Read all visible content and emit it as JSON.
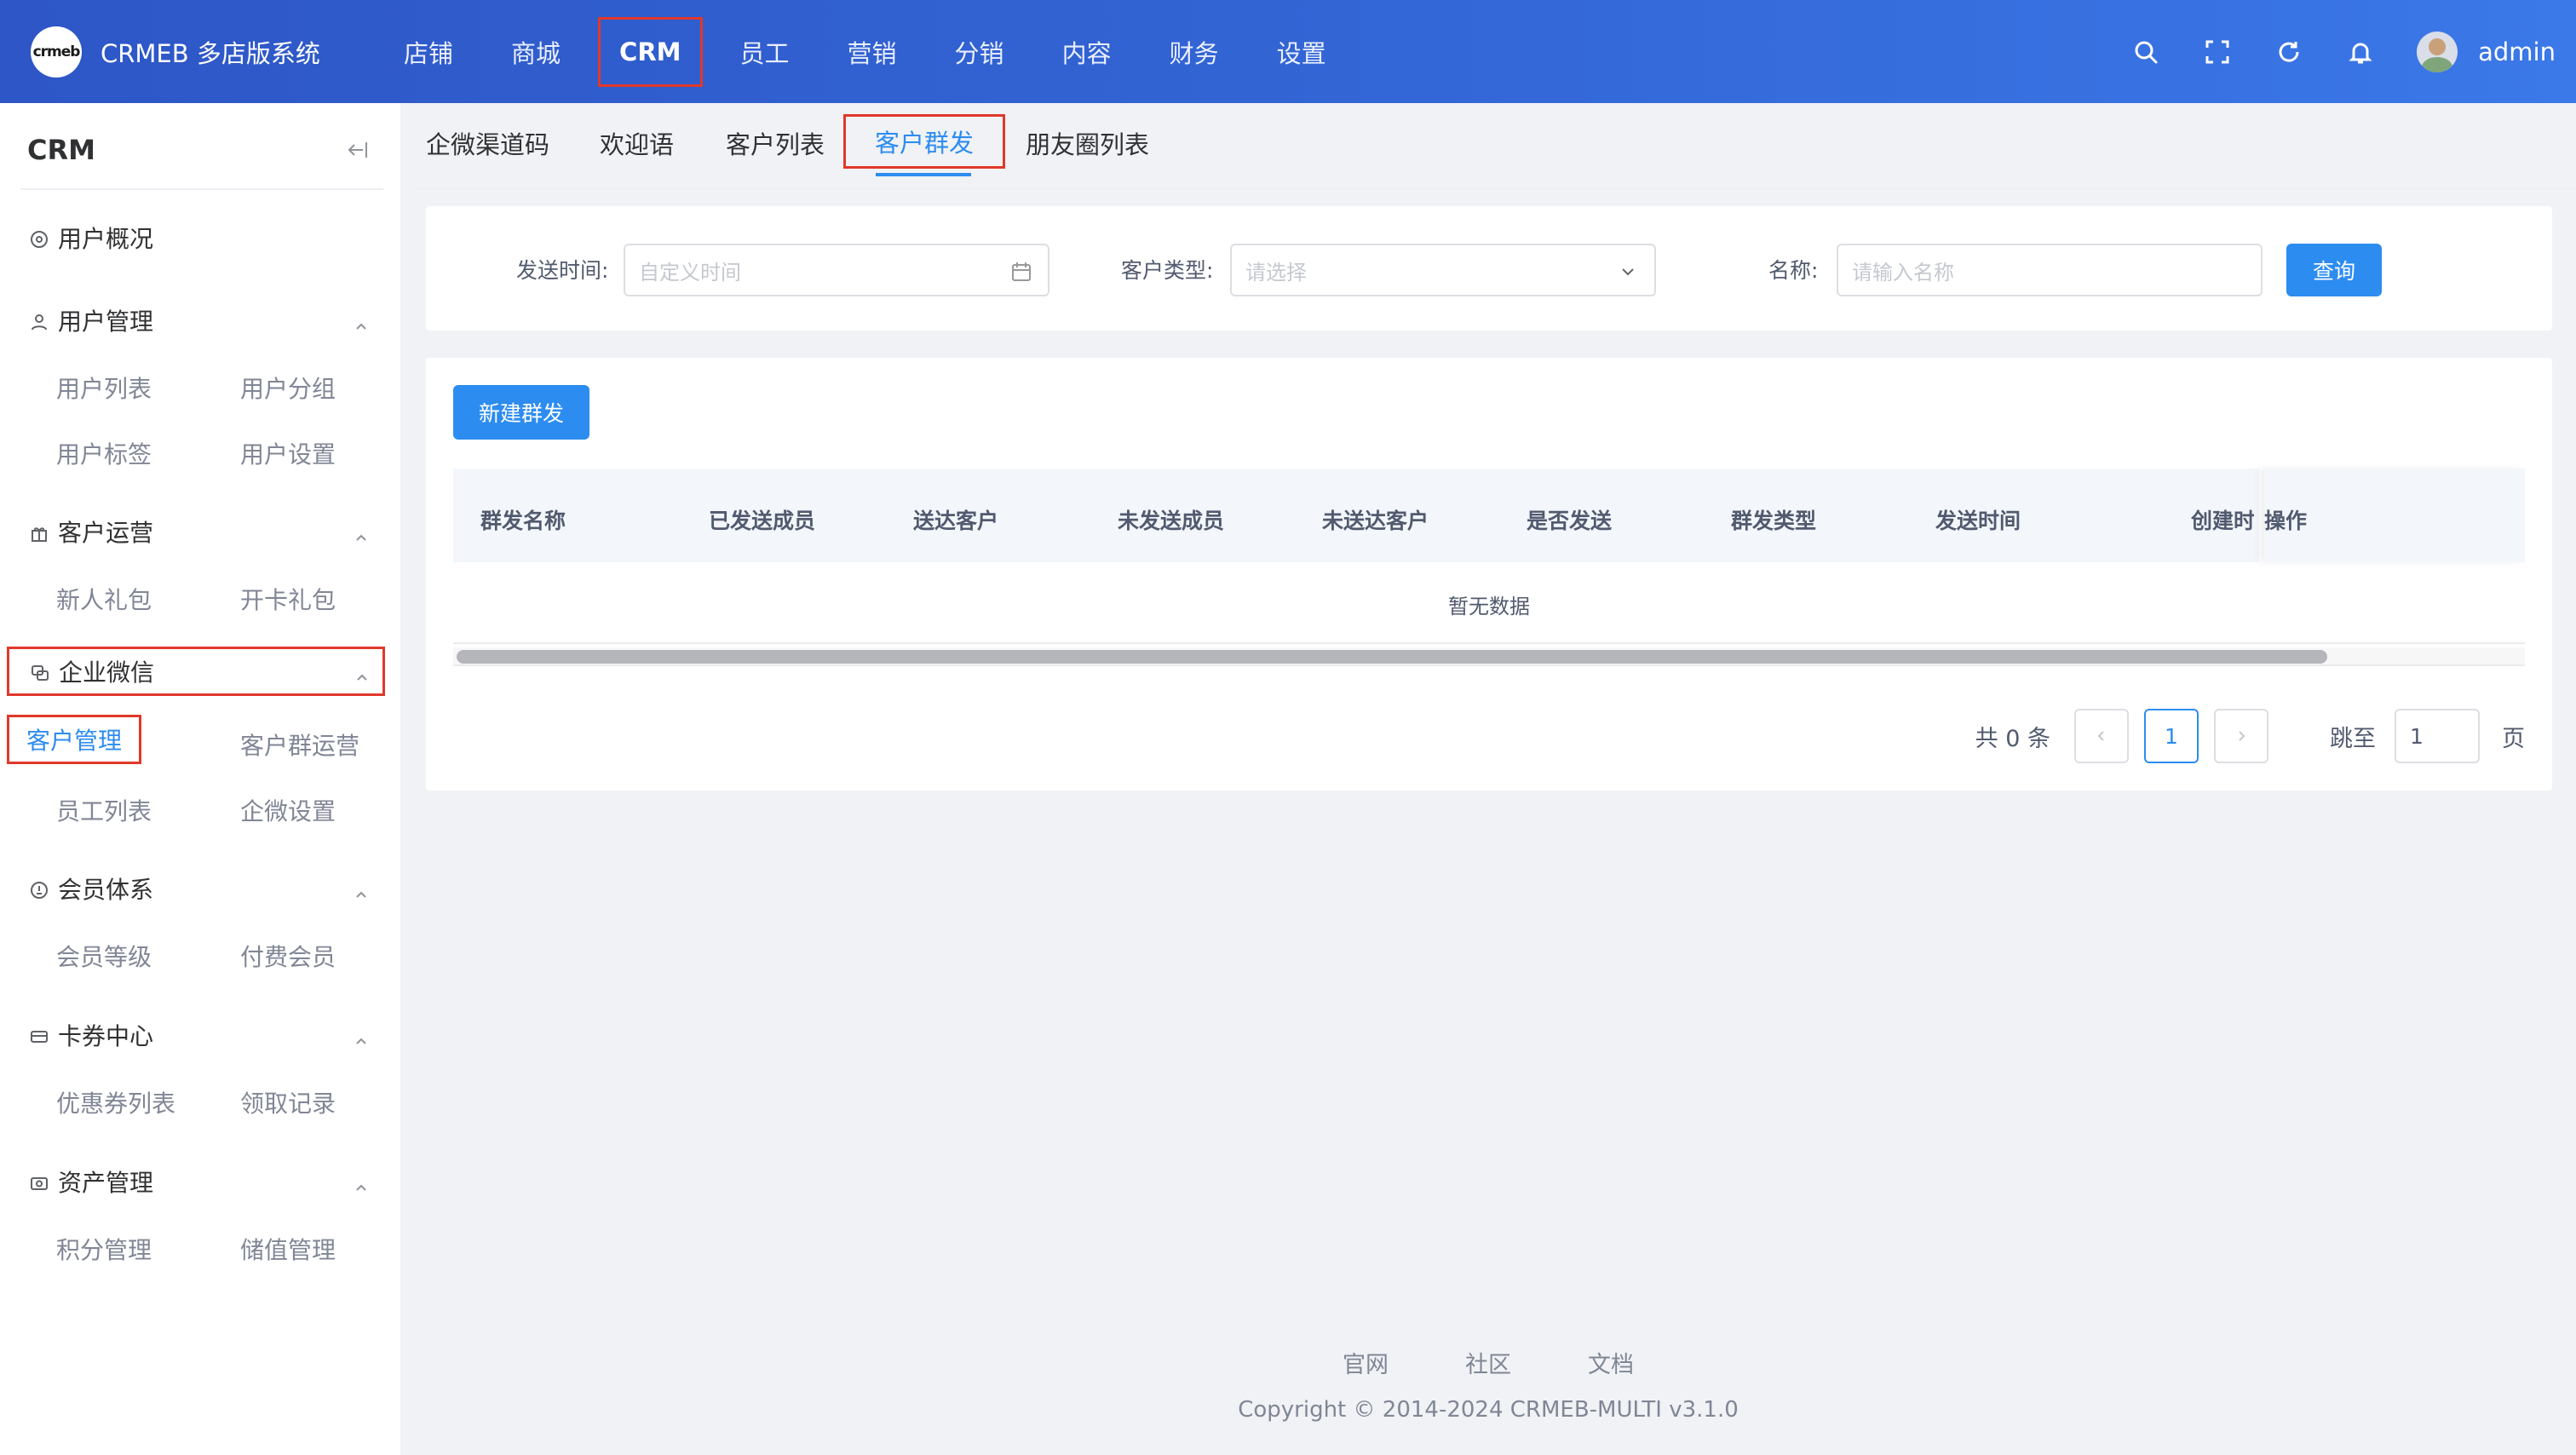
{
  "header": {
    "logo_text": "crmeb",
    "brand": "CRMEB 多店版系统",
    "nav": [
      "店铺",
      "商城",
      "CRM",
      "员工",
      "营销",
      "分销",
      "内容",
      "财务",
      "设置"
    ],
    "active_nav": "CRM",
    "username": "admin",
    "icons": [
      "search-icon",
      "fullscreen-icon",
      "refresh-icon",
      "bell-icon"
    ]
  },
  "sidebar": {
    "title": "CRM",
    "groups": [
      {
        "label": "用户概况",
        "icon": "dashboard-icon",
        "items": []
      },
      {
        "label": "用户管理",
        "icon": "user-icon",
        "items": [
          "用户列表",
          "用户分组",
          "用户标签",
          "用户设置"
        ]
      },
      {
        "label": "客户运营",
        "icon": "gift-icon",
        "items": [
          "新人礼包",
          "开卡礼包"
        ]
      },
      {
        "label": "企业微信",
        "icon": "wechat-work-icon",
        "items": [
          "客户管理",
          "客户群运营",
          "员工列表",
          "企微设置"
        ]
      },
      {
        "label": "会员体系",
        "icon": "member-icon",
        "items": [
          "会员等级",
          "付费会员"
        ]
      },
      {
        "label": "卡券中心",
        "icon": "card-icon",
        "items": [
          "优惠券列表",
          "领取记录"
        ]
      },
      {
        "label": "资产管理",
        "icon": "wallet-icon",
        "items": [
          "积分管理",
          "储值管理"
        ]
      }
    ],
    "active_item": "客户管理"
  },
  "tabs": [
    "企微渠道码",
    "欢迎语",
    "客户列表",
    "客户群发",
    "朋友圈列表"
  ],
  "active_tab": "客户群发",
  "filters": {
    "send_time_label": "发送时间:",
    "send_time_placeholder": "自定义时间",
    "customer_type_label": "客户类型:",
    "customer_type_placeholder": "请选择",
    "name_label": "名称:",
    "name_placeholder": "请输入名称",
    "query_button": "查询"
  },
  "list": {
    "new_button": "新建群发",
    "columns": [
      "群发名称",
      "已发送成员",
      "送达客户",
      "未发送成员",
      "未送达客户",
      "是否发送",
      "群发类型",
      "发送时间",
      "创建时",
      "操作"
    ],
    "empty_text": "暂无数据"
  },
  "pagination": {
    "total_text": "共 0 条",
    "current_page": "1",
    "jump_label": "跳至",
    "jump_value": "1",
    "page_suffix": "页"
  },
  "footer": {
    "links": [
      "官网",
      "社区",
      "文档"
    ],
    "copyright": "Copyright © 2014-2024 CRMEB-MULTI v3.1.0"
  }
}
